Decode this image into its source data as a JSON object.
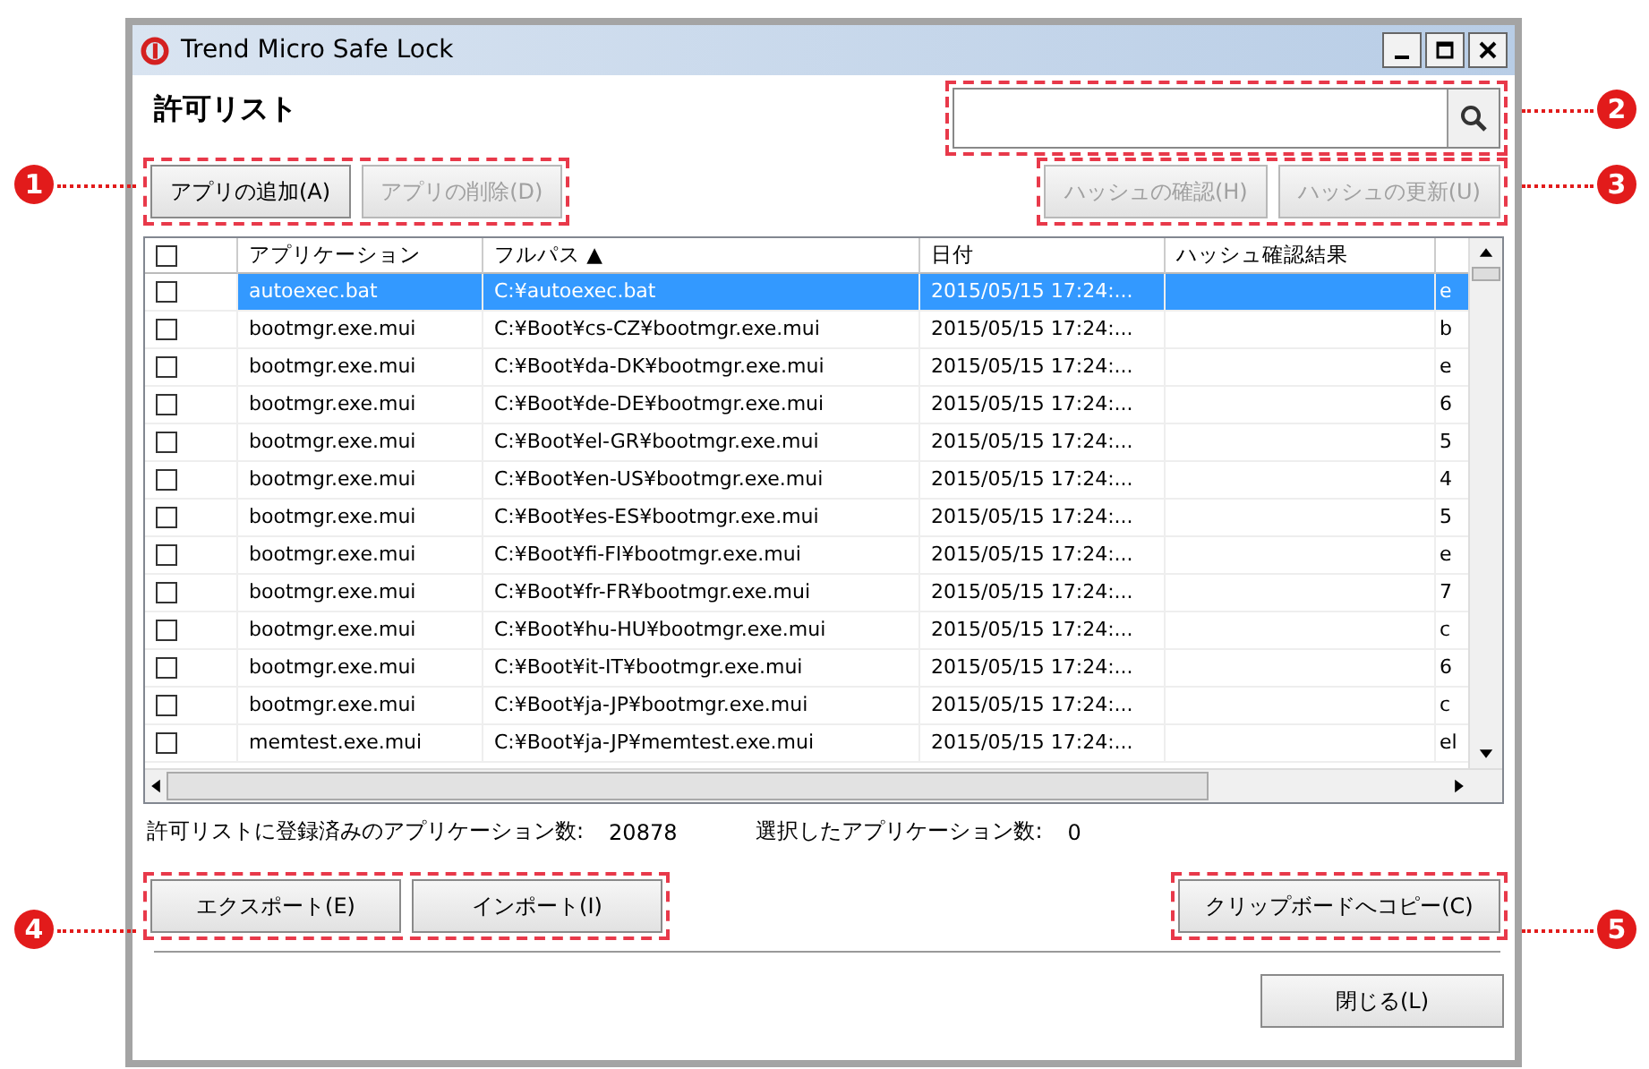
{
  "window": {
    "title": "Trend Micro Safe Lock"
  },
  "heading": "許可リスト",
  "left_buttons": [
    {
      "label": "アプリの追加(A)",
      "disabled": false
    },
    {
      "label": "アプリの削除(D)",
      "disabled": true
    }
  ],
  "right_buttons": [
    {
      "label": "ハッシュの確認(H)",
      "disabled": true
    },
    {
      "label": "ハッシュの更新(U)",
      "disabled": true
    }
  ],
  "table": {
    "columns": [
      "アプリケーション",
      "フルパス ▲",
      "日付",
      "ハッシュ確認結果"
    ],
    "header_checked": false,
    "rows": [
      {
        "checked": false,
        "selected": true,
        "cells": [
          "autoexec.bat",
          "C:¥autoexec.bat",
          "2015/05/15 17:24:...",
          "",
          "e"
        ]
      },
      {
        "checked": false,
        "selected": false,
        "cells": [
          "bootmgr.exe.mui",
          "C:¥Boot¥cs-CZ¥bootmgr.exe.mui",
          "2015/05/15 17:24:...",
          "",
          "b"
        ]
      },
      {
        "checked": false,
        "selected": false,
        "cells": [
          "bootmgr.exe.mui",
          "C:¥Boot¥da-DK¥bootmgr.exe.mui",
          "2015/05/15 17:24:...",
          "",
          "e"
        ]
      },
      {
        "checked": false,
        "selected": false,
        "cells": [
          "bootmgr.exe.mui",
          "C:¥Boot¥de-DE¥bootmgr.exe.mui",
          "2015/05/15 17:24:...",
          "",
          "6"
        ]
      },
      {
        "checked": false,
        "selected": false,
        "cells": [
          "bootmgr.exe.mui",
          "C:¥Boot¥el-GR¥bootmgr.exe.mui",
          "2015/05/15 17:24:...",
          "",
          "5"
        ]
      },
      {
        "checked": false,
        "selected": false,
        "cells": [
          "bootmgr.exe.mui",
          "C:¥Boot¥en-US¥bootmgr.exe.mui",
          "2015/05/15 17:24:...",
          "",
          "4"
        ]
      },
      {
        "checked": false,
        "selected": false,
        "cells": [
          "bootmgr.exe.mui",
          "C:¥Boot¥es-ES¥bootmgr.exe.mui",
          "2015/05/15 17:24:...",
          "",
          "5"
        ]
      },
      {
        "checked": false,
        "selected": false,
        "cells": [
          "bootmgr.exe.mui",
          "C:¥Boot¥fi-FI¥bootmgr.exe.mui",
          "2015/05/15 17:24:...",
          "",
          "e"
        ]
      },
      {
        "checked": false,
        "selected": false,
        "cells": [
          "bootmgr.exe.mui",
          "C:¥Boot¥fr-FR¥bootmgr.exe.mui",
          "2015/05/15 17:24:...",
          "",
          "7"
        ]
      },
      {
        "checked": false,
        "selected": false,
        "cells": [
          "bootmgr.exe.mui",
          "C:¥Boot¥hu-HU¥bootmgr.exe.mui",
          "2015/05/15 17:24:...",
          "",
          "c"
        ]
      },
      {
        "checked": false,
        "selected": false,
        "cells": [
          "bootmgr.exe.mui",
          "C:¥Boot¥it-IT¥bootmgr.exe.mui",
          "2015/05/15 17:24:...",
          "",
          "6"
        ]
      },
      {
        "checked": false,
        "selected": false,
        "cells": [
          "bootmgr.exe.mui",
          "C:¥Boot¥ja-JP¥bootmgr.exe.mui",
          "2015/05/15 17:24:...",
          "",
          "c"
        ]
      },
      {
        "checked": false,
        "selected": false,
        "cells": [
          "memtest.exe.mui",
          "C:¥Boot¥ja-JP¥memtest.exe.mui",
          "2015/05/15 17:24:...",
          "",
          "el"
        ]
      }
    ]
  },
  "counts": [
    {
      "label": "許可リストに登録済みのアプリケーション数:",
      "value": "20878"
    },
    {
      "label": "選択したアプリケーション数:",
      "value": "0"
    }
  ],
  "bottom_left_buttons": [
    {
      "label": "エクスポート(E)"
    },
    {
      "label": "インポート(I)"
    }
  ],
  "bottom_right_button": {
    "label": "クリップボードへコピー(C)"
  },
  "close_button": {
    "label": "閉じる(L)"
  },
  "callouts": [
    "2",
    "1",
    "3",
    "4",
    "5"
  ]
}
